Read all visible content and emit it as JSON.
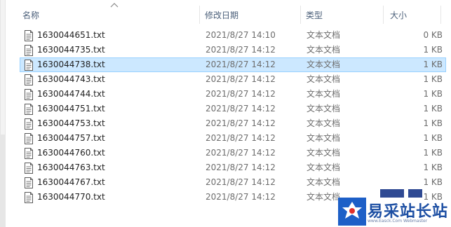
{
  "columns": {
    "name": "名称",
    "date": "修改日期",
    "type": "类型",
    "size": "大小"
  },
  "files": [
    {
      "name": "1630044651.txt",
      "date": "2021/8/27 14:10",
      "type": "文本文档",
      "size": "0 KB"
    },
    {
      "name": "1630044735.txt",
      "date": "2021/8/27 14:12",
      "type": "文本文档",
      "size": "1 KB"
    },
    {
      "name": "1630044738.txt",
      "date": "2021/8/27 14:12",
      "type": "文本文档",
      "size": "1 KB",
      "selected": true
    },
    {
      "name": "1630044743.txt",
      "date": "2021/8/27 14:12",
      "type": "文本文档",
      "size": "1 KB"
    },
    {
      "name": "1630044744.txt",
      "date": "2021/8/27 14:12",
      "type": "文本文档",
      "size": "1 KB"
    },
    {
      "name": "1630044751.txt",
      "date": "2021/8/27 14:12",
      "type": "文本文档",
      "size": "1 KB"
    },
    {
      "name": "1630044753.txt",
      "date": "2021/8/27 14:12",
      "type": "文本文档",
      "size": "1 KB"
    },
    {
      "name": "1630044757.txt",
      "date": "2021/8/27 14:12",
      "type": "文本文档",
      "size": "1 KB"
    },
    {
      "name": "1630044760.txt",
      "date": "2021/8/27 14:12",
      "type": "文本文档",
      "size": "1 KB"
    },
    {
      "name": "1630044763.txt",
      "date": "2021/8/27 14:12",
      "type": "文本文档",
      "size": "1 KB"
    },
    {
      "name": "1630044767.txt",
      "date": "2021/8/27 14:12",
      "type": "文本文档",
      "size": "1 KB"
    },
    {
      "name": "1630044770.txt",
      "date": "2021/8/27 14:12",
      "type": "文本文档",
      "size": "1 KB"
    }
  ],
  "file_icon": "text-file-icon",
  "sort_icon": "sort-ascending-icon",
  "watermark": {
    "brand": "易采站长站",
    "site": "www.Easck.Com Webmaster"
  },
  "colors": {
    "selection_bg": "#cce8ff",
    "selection_border": "#99d1ff",
    "header_text": "#4c607a",
    "secondary_text": "#6d6d6d"
  }
}
